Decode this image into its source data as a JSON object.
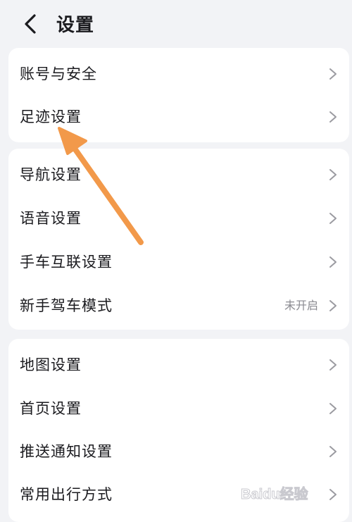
{
  "header": {
    "title": "设置"
  },
  "groups": [
    {
      "items": [
        {
          "label": "账号与安全"
        },
        {
          "label": "足迹设置"
        }
      ]
    },
    {
      "items": [
        {
          "label": "导航设置"
        },
        {
          "label": "语音设置"
        },
        {
          "label": "手车互联设置"
        },
        {
          "label": "新手驾车模式",
          "value": "未开启"
        }
      ]
    },
    {
      "items": [
        {
          "label": "地图设置"
        },
        {
          "label": "首页设置"
        },
        {
          "label": "推送通知设置"
        },
        {
          "label": "常用出行方式"
        }
      ]
    }
  ],
  "annotation": {
    "arrow_color": "#f2994a"
  },
  "watermark": {
    "text": "Baidu经验"
  },
  "colors": {
    "background": "#f2f3f6",
    "card": "#ffffff",
    "text": "#1b1b1f",
    "secondary_text": "#8a8a90",
    "chevron": "#9b9ba1"
  }
}
